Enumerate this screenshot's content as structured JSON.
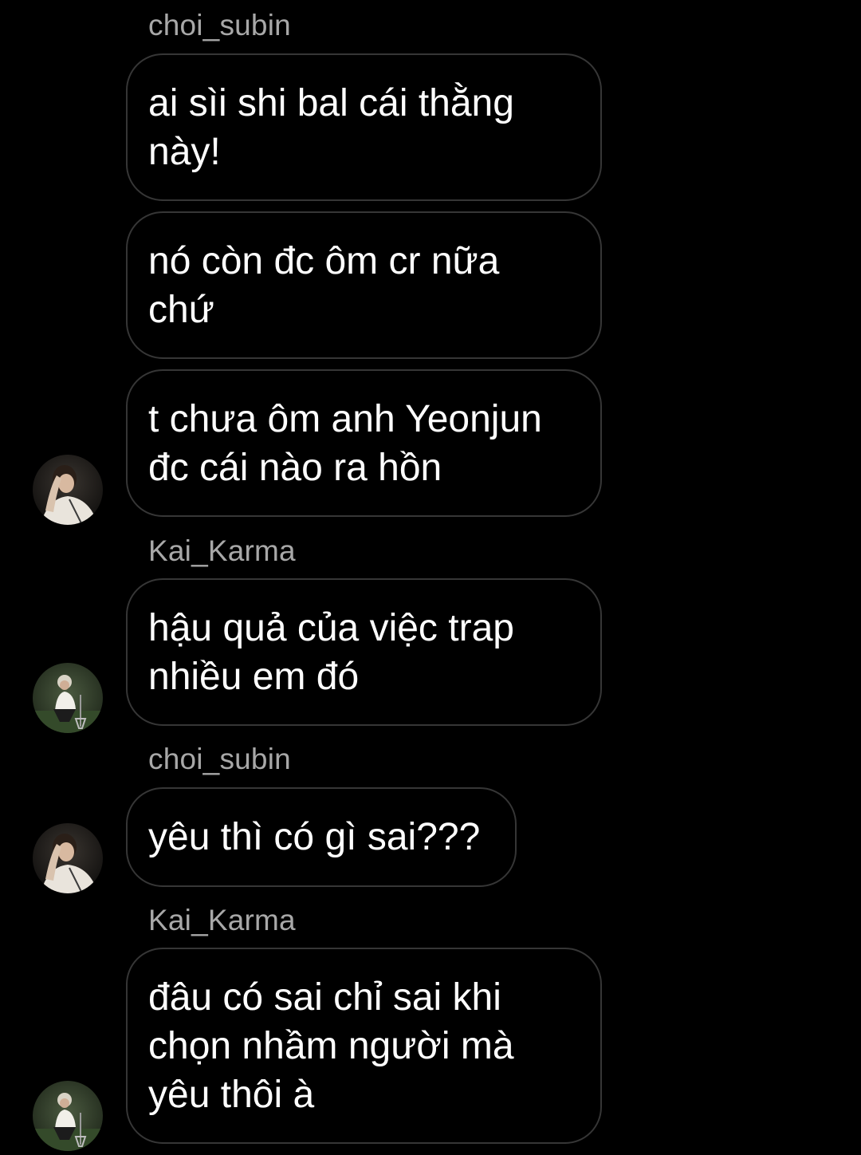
{
  "chat": {
    "groups": [
      {
        "sender": "choi_subin",
        "messages": [
          {
            "lines": [
              "ai sìi shi bal cái thằng",
              "này!"
            ]
          },
          {
            "lines": [
              "nó còn đc ôm cr nữa",
              "chứ"
            ]
          },
          {
            "lines": [
              "t chưa ôm anh Yeonjun",
              "đc cái nào ra hồn"
            ]
          }
        ],
        "avatar": "choi_subin-avatar"
      },
      {
        "sender": "Kai_Karma",
        "messages": [
          {
            "lines": [
              "hậu quả của việc trap",
              "nhiều em đó"
            ]
          }
        ],
        "avatar": "Kai_Karma-avatar"
      },
      {
        "sender": "choi_subin",
        "messages": [
          {
            "lines": [
              "yêu thì có gì sai???"
            ]
          }
        ],
        "avatar": "choi_subin-avatar"
      },
      {
        "sender": "Kai_Karma",
        "messages": [
          {
            "lines": [
              "đâu có sai chỉ sai khi",
              "chọn nhầm người mà",
              "yêu thôi à"
            ]
          }
        ],
        "avatar": "Kai_Karma-avatar"
      }
    ]
  },
  "colors": {
    "background": "#000000",
    "bubble_border": "#363636",
    "message_text": "#ffffff",
    "sender_text": "#a8a8a8"
  }
}
